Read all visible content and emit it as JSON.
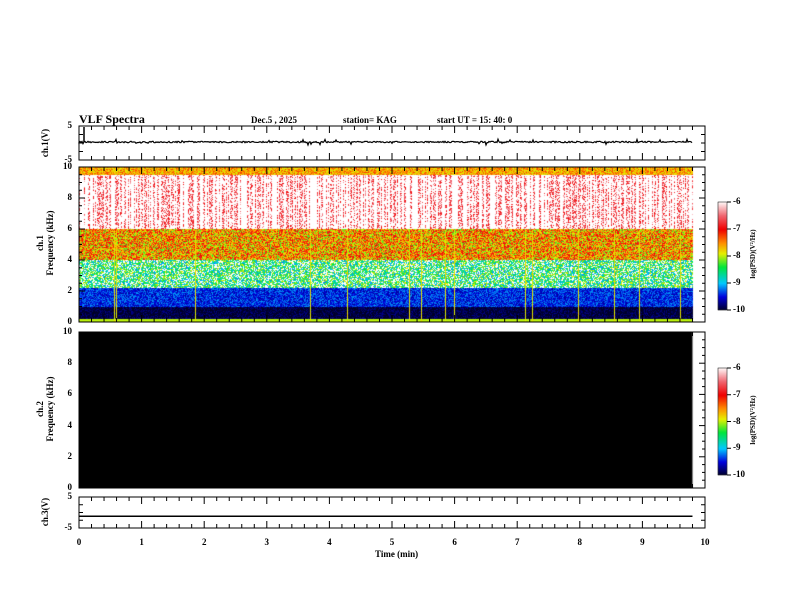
{
  "header": {
    "title": "VLF Spectra",
    "date": "Dec.5 , 2025",
    "station": "station= KAG",
    "start": "start  UT =   15: 40: 0"
  },
  "chart_data": [
    {
      "type": "line",
      "name": "ch1",
      "ylabel": "ch.1(V)",
      "ylim": [
        -5,
        5
      ],
      "yticks": [
        "5",
        "-5"
      ],
      "xlim": [
        0,
        10
      ],
      "baseline": 0,
      "data_end": 9.8
    },
    {
      "type": "heatmap",
      "ylabel": "Frequency (kHz)",
      "channel_label": "ch.1",
      "ylim": [
        0,
        10
      ],
      "yticks": [
        "0",
        "2",
        "4",
        "6",
        "8",
        "10"
      ],
      "xlim": [
        0,
        10
      ],
      "data_end": 9.8,
      "colorbar": {
        "label": "log(PSD)(V²/Hz)",
        "range": [
          -10,
          -6
        ],
        "ticks": [
          "-6",
          "-7",
          "-8",
          "-9",
          "-10"
        ]
      }
    },
    {
      "type": "heatmap",
      "ylabel": "Frequency (kHz)",
      "channel_label": "ch.2",
      "ylim": [
        0,
        10
      ],
      "yticks": [
        "0",
        "2",
        "4",
        "6",
        "8",
        "10"
      ],
      "xlim": [
        0,
        10
      ],
      "data_end": 9.8,
      "fill": "#000000",
      "colorbar": {
        "label": "log(PSD)(V²/Hz)",
        "range": [
          -10,
          -6
        ],
        "ticks": [
          "-6",
          "-7",
          "-8",
          "-9",
          "-10"
        ]
      }
    },
    {
      "type": "line",
      "name": "ch3",
      "ylabel": "ch.3(V)",
      "ylim": [
        -5,
        5
      ],
      "yticks": [
        "5",
        "-5"
      ],
      "xlim": [
        0,
        10
      ],
      "constant": -1.2,
      "data_end": 9.8
    }
  ],
  "xaxis": {
    "label": "Time (min)",
    "ticks": [
      "0",
      "1",
      "2",
      "3",
      "4",
      "5",
      "6",
      "7",
      "8",
      "9",
      "10"
    ]
  }
}
